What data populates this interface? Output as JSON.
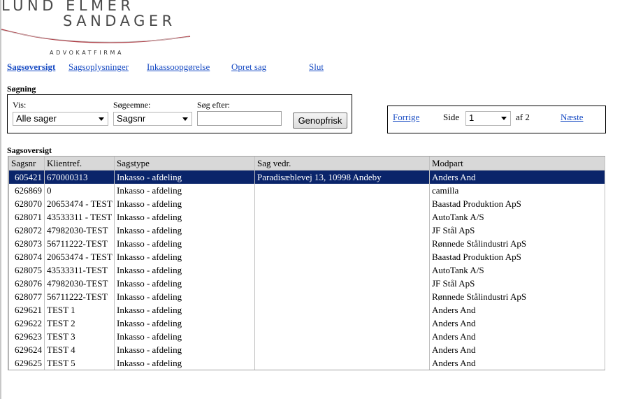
{
  "logo": {
    "line1": "LUND ELMER",
    "line2": "SANDAGER",
    "line3": "ADVOKATFIRMA"
  },
  "nav": {
    "items": [
      "Sagsoversigt",
      "Sagsoplysninger",
      "Inkassoopgørelse",
      "Opret sag",
      "Slut"
    ]
  },
  "search": {
    "title": "Søgning",
    "vis_label": "Vis:",
    "vis_value": "Alle sager",
    "emne_label": "Søgeemne:",
    "emne_value": "Sagsnr",
    "efter_label": "Søg efter:",
    "efter_value": "",
    "refresh_label": "Genopfrisk"
  },
  "pager": {
    "prev": "Forrige",
    "side_label": "Side",
    "page_value": "1",
    "of_label": "af 2",
    "next": "Næste"
  },
  "overview": {
    "title": "Sagsoversigt",
    "columns": [
      "Sagsnr",
      "Klientref.",
      "Sagstype",
      "Sag vedr.",
      "Modpart"
    ],
    "rows": [
      [
        "605421",
        "670000313",
        "Inkasso - afdeling",
        "Paradisæblevej 13, 10998 Andeby",
        "Anders And"
      ],
      [
        "626869",
        "0",
        "Inkasso - afdeling",
        "",
        "camilla"
      ],
      [
        "628070",
        "20653474 - TEST",
        "Inkasso - afdeling",
        "",
        "Baastad Produktion ApS"
      ],
      [
        "628071",
        "43533311 - TEST",
        "Inkasso - afdeling",
        "",
        "AutoTank A/S"
      ],
      [
        "628072",
        "47982030-TEST",
        "Inkasso - afdeling",
        "",
        "JF Stål ApS"
      ],
      [
        "628073",
        "56711222-TEST",
        "Inkasso - afdeling",
        "",
        "Rønnede Stålindustri ApS"
      ],
      [
        "628074",
        "20653474 - TEST",
        "Inkasso - afdeling",
        "",
        "Baastad Produktion ApS"
      ],
      [
        "628075",
        "43533311-TEST",
        "Inkasso - afdeling",
        "",
        "AutoTank A/S"
      ],
      [
        "628076",
        "47982030-TEST",
        "Inkasso - afdeling",
        "",
        "JF Stål ApS"
      ],
      [
        "628077",
        "56711222-TEST",
        "Inkasso - afdeling",
        "",
        "Rønnede Stålindustri ApS"
      ],
      [
        "629621",
        "TEST 1",
        "Inkasso - afdeling",
        "",
        "Anders And"
      ],
      [
        "629622",
        "TEST 2",
        "Inkasso - afdeling",
        "",
        "Anders And"
      ],
      [
        "629623",
        "TEST 3",
        "Inkasso - afdeling",
        "",
        "Anders And"
      ],
      [
        "629624",
        "TEST 4",
        "Inkasso - afdeling",
        "",
        "Anders And"
      ],
      [
        "629625",
        "TEST 5",
        "Inkasso - afdeling",
        "",
        "Anders And"
      ]
    ]
  },
  "colors": {
    "link": "#1a4dc4",
    "selected_row": "#0a246a",
    "header_bg": "#d8d8d8",
    "logo_swoosh": "#9e1b22"
  }
}
